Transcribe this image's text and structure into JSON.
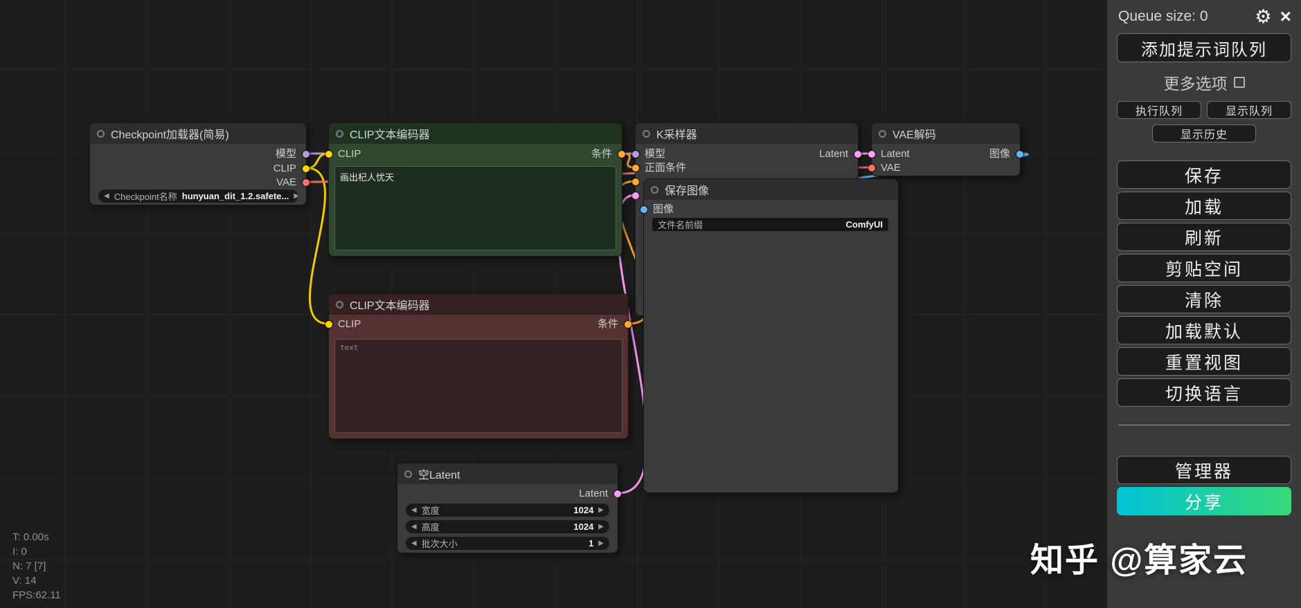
{
  "nodes": {
    "checkpoint": {
      "title": "Checkpoint加载器(简易)",
      "outputs": {
        "model": "模型",
        "clip": "CLIP",
        "vae": "VAE"
      },
      "widget": {
        "label": "Checkpoint名称",
        "value": "hunyuan_dit_1.2.safete..."
      }
    },
    "clip_encode_pos": {
      "title": "CLIP文本编码器",
      "input_clip": "CLIP",
      "output_cond": "条件",
      "text": "画出杞人忧天"
    },
    "clip_encode_neg": {
      "title": "CLIP文本编码器",
      "input_clip": "CLIP",
      "output_cond": "条件",
      "placeholder": "text"
    },
    "ksampler": {
      "title": "K采样器",
      "input_model": "模型",
      "input_positive": "正面条件",
      "output_latent": "Latent"
    },
    "vae_decode": {
      "title": "VAE解码",
      "input_latent": "Latent",
      "input_vae": "VAE",
      "output_image": "图像"
    },
    "save_image": {
      "title": "保存图像",
      "input_image": "图像",
      "widget": {
        "label": "文件名前缀",
        "value": "ComfyUI"
      }
    },
    "empty_latent": {
      "title": "空Latent",
      "output_latent": "Latent",
      "widgets": [
        {
          "label": "宽度",
          "value": "1024"
        },
        {
          "label": "高度",
          "value": "1024"
        },
        {
          "label": "批次大小",
          "value": "1"
        }
      ]
    }
  },
  "sidebar": {
    "queue_size": "Queue size: 0",
    "queue_prompt_button": "添加提示词队列",
    "extra_options_label": "更多选项",
    "queue_front_button": "执行队列",
    "view_queue_button": "显示队列",
    "view_history_button": "显示历史",
    "action_buttons": [
      "保存",
      "加载",
      "刷新",
      "剪贴空间",
      "清除",
      "加载默认",
      "重置视图",
      "切换语言"
    ],
    "manager_button": "管理器",
    "share_button": "分享"
  },
  "hud": {
    "lines": [
      "T: 0.00s",
      "I: 0",
      "N: 7 [7]",
      "V: 14",
      "FPS:62.11"
    ]
  },
  "watermark": "知乎 @算家云",
  "icons": {
    "gear": "⚙",
    "close": "×",
    "arrow_left": "◀",
    "arrow_right": "▶"
  },
  "colors": {
    "model": "#B39DDB",
    "clip": "#FFD500",
    "vae": "#FF6E6E",
    "conditioning": "#FFA931",
    "latent": "#FF9CF9",
    "image": "#64B5F6",
    "share_gradient_start": "#00C3D7",
    "share_gradient_end": "#38D977"
  }
}
